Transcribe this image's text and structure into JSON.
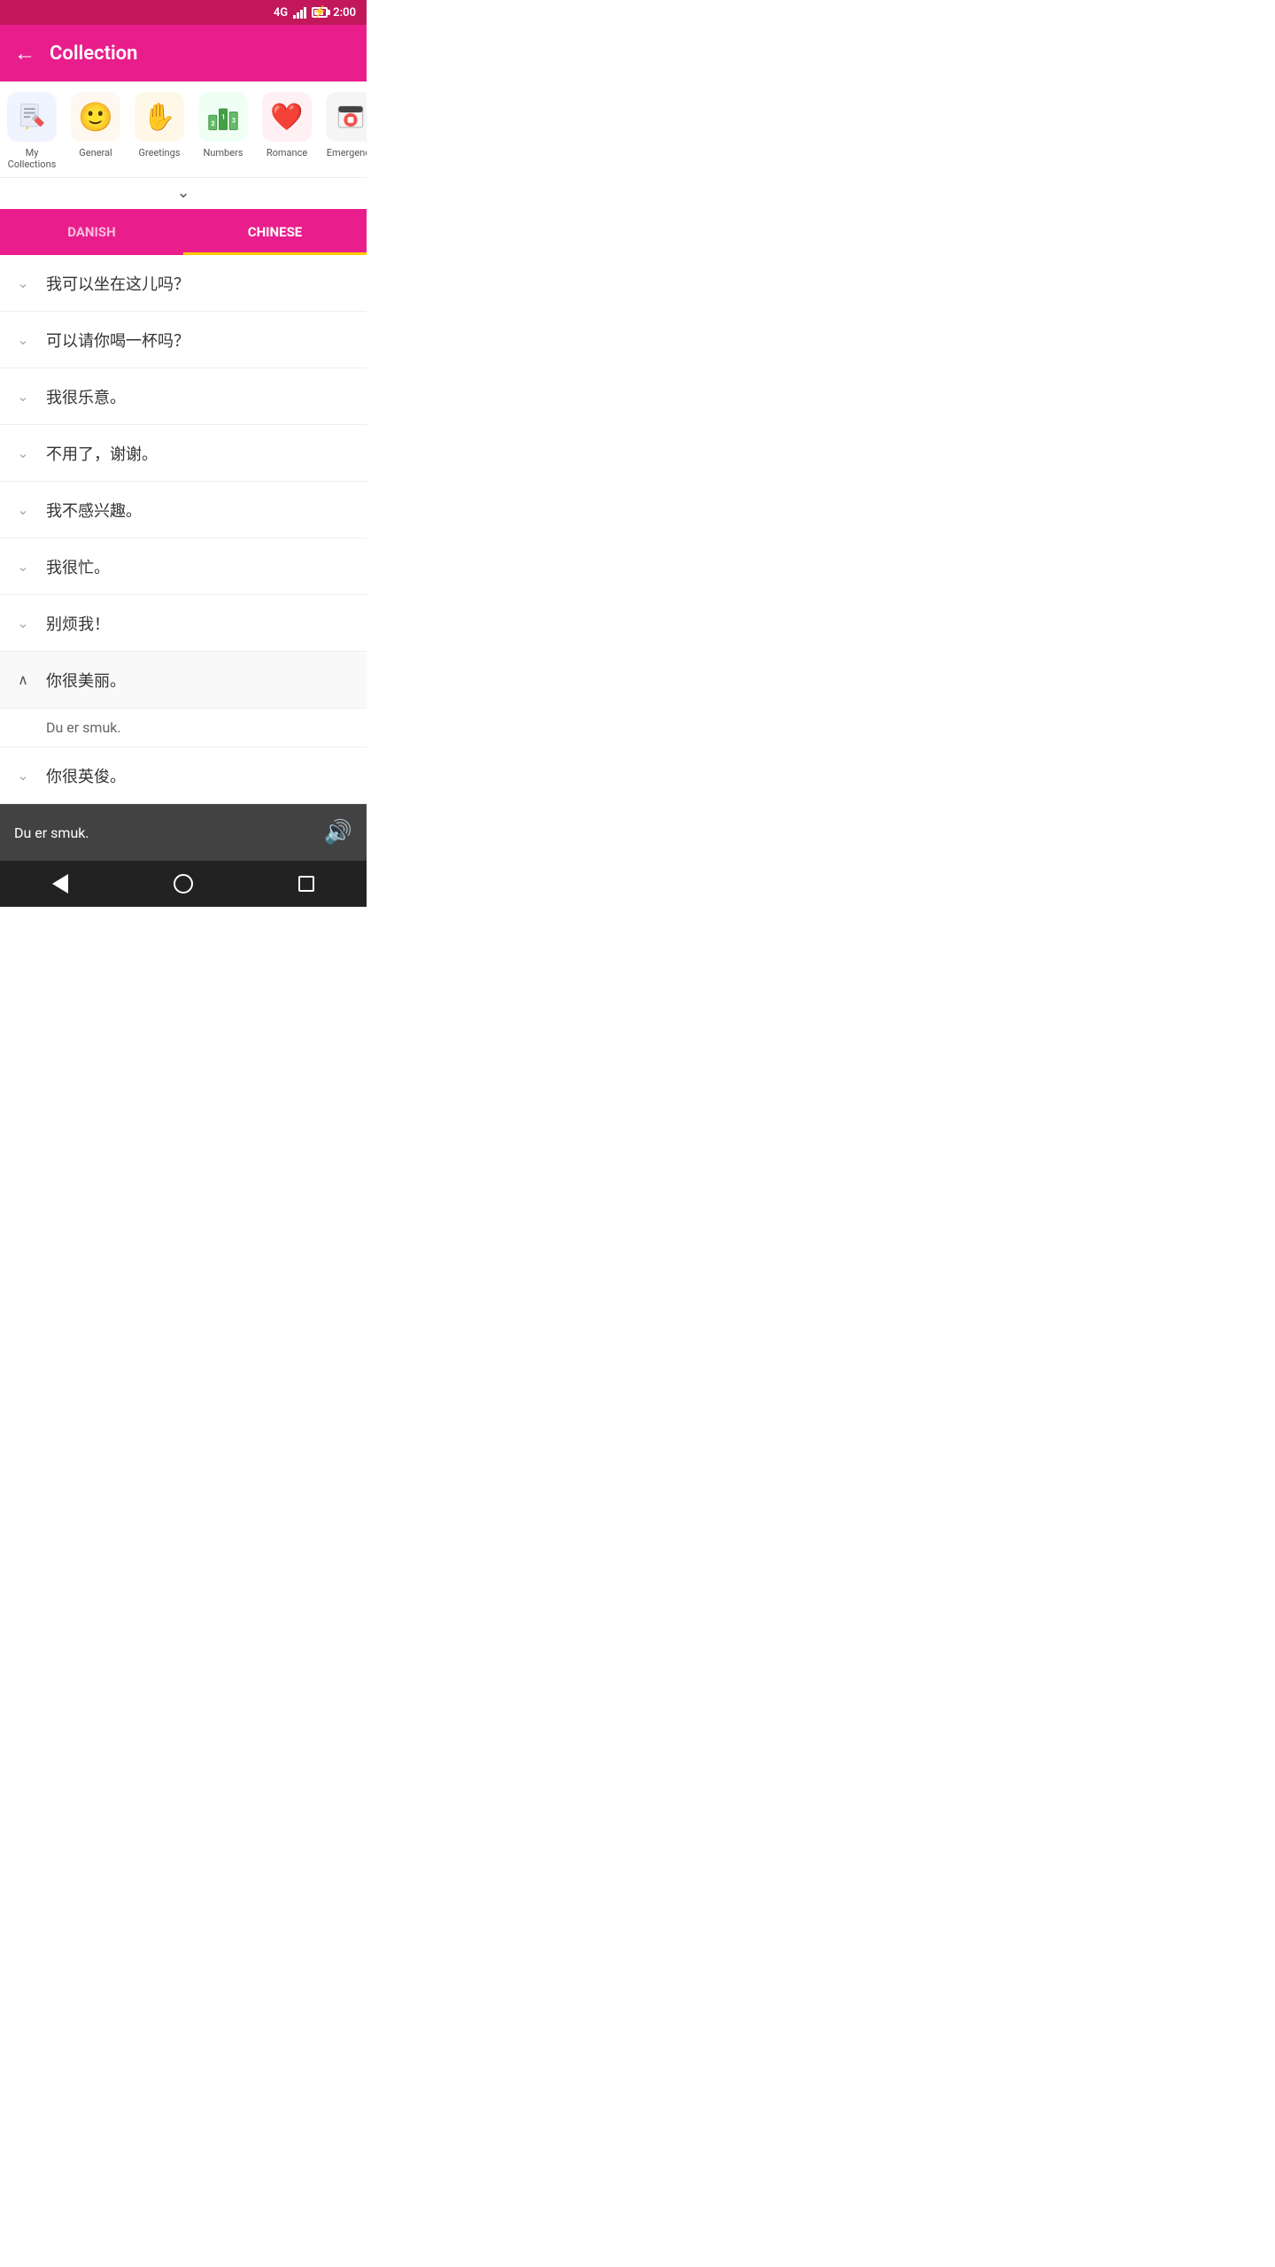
{
  "statusBar": {
    "network": "4G",
    "time": "2:00"
  },
  "header": {
    "backLabel": "←",
    "title": "Collection"
  },
  "categories": [
    {
      "id": "mycollections",
      "label": "My Collections",
      "iconType": "pencil"
    },
    {
      "id": "general",
      "label": "General",
      "iconType": "face"
    },
    {
      "id": "greetings",
      "label": "Greetings",
      "iconType": "hand"
    },
    {
      "id": "numbers",
      "label": "Numbers",
      "iconType": "numbers"
    },
    {
      "id": "romance",
      "label": "Romance",
      "iconType": "heart"
    },
    {
      "id": "emergency",
      "label": "Emergency",
      "iconType": "firstaid"
    }
  ],
  "expandArrow": "⌄",
  "tabs": [
    {
      "id": "danish",
      "label": "DANISH",
      "active": false
    },
    {
      "id": "chinese",
      "label": "CHINESE",
      "active": true
    }
  ],
  "phrases": [
    {
      "id": 1,
      "text": "我可以坐在这儿吗？",
      "expanded": false
    },
    {
      "id": 2,
      "text": "可以请你喝一杯吗？",
      "expanded": false
    },
    {
      "id": 3,
      "text": "我很乐意。",
      "expanded": false
    },
    {
      "id": 4,
      "text": "不用了，谢谢。",
      "expanded": false
    },
    {
      "id": 5,
      "text": "我不感兴趣。",
      "expanded": false
    },
    {
      "id": 6,
      "text": "我很忙。",
      "expanded": false
    },
    {
      "id": 7,
      "text": "别烦我！",
      "expanded": false
    },
    {
      "id": 8,
      "text": "你很美丽。",
      "expanded": true
    },
    {
      "id": 9,
      "text": "你很英俊。",
      "expanded": false
    }
  ],
  "expandedSub": {
    "text": "Du er smuk."
  },
  "bottomBar": {
    "text": "Du er smuk.",
    "speakerIcon": "🔊"
  },
  "navBar": {
    "back": "",
    "home": "",
    "recents": ""
  }
}
